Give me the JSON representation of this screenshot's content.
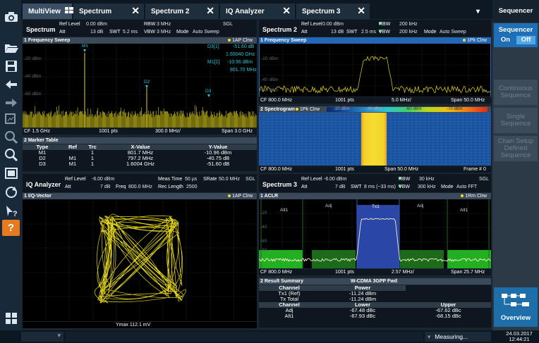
{
  "tabs": [
    {
      "label": "MultiView",
      "active": true
    },
    {
      "label": "Spectrum"
    },
    {
      "label": "Spectrum 2"
    },
    {
      "label": "IQ Analyzer"
    },
    {
      "label": "Spectrum 3"
    }
  ],
  "sequencer": {
    "title": "Sequencer",
    "switch_label": "Sequencer",
    "on": "On",
    "off": "Off",
    "continuous": "Continuous Sequence",
    "single": "Single Sequence",
    "chan_setup": "Chan Setup Defined Sequence",
    "overview": "Overview"
  },
  "spec1": {
    "name": "Spectrum",
    "ref_level_l": "Ref Level",
    "ref_level": "0.00 dBm",
    "att_l": "Att",
    "att": "13 dB",
    "swt_l": "SWT",
    "swt": "5.2 ms",
    "rbw_l": "RBW",
    "rbw": "3 MHz",
    "vbw_l": "VBW",
    "vbw": "3 MHz",
    "mode_l": "Mode",
    "mode": "Auto Sweep",
    "sgl": "SGL",
    "window": "1 Frequency Sweep",
    "trace": "1AP Clrw",
    "grid": [
      "-20 dBm",
      "-40 dBm",
      "-60 dBm"
    ],
    "markers": [
      "M1",
      "D2",
      "D3"
    ],
    "readout": [
      "D3[1]",
      "-51.60 dB",
      "1.60040 GHz",
      "M1[1]",
      "-10.96 dBm",
      "801.70 MHz"
    ],
    "cf": "CF 1.5 GHz",
    "pts": "1001 pts",
    "div": "300.0 MHz/",
    "span": "Span 3.0 GHz"
  },
  "marker_table": {
    "title": "2 Marker Table",
    "headers": [
      "Type",
      "Ref",
      "Trc",
      "X-Value",
      "Y-Value"
    ],
    "rows": [
      [
        "M1",
        "",
        "1",
        "801.7 MHz",
        "-10.96 dBm"
      ],
      [
        "D2",
        "M1",
        "1",
        "797.2 MHz",
        "-40.75 dB"
      ],
      [
        "D3",
        "M1",
        "1",
        "1.6004 GHz",
        "-51.60 dB"
      ]
    ]
  },
  "iq": {
    "name": "IQ Analyzer",
    "ref_level_l": "Ref Level",
    "ref_level": "-6.00 dBm",
    "att_l": "Att",
    "att": "7 dB",
    "freq_l": "Freq",
    "freq": "800.0 MHz",
    "meas_l": "Meas Time",
    "meas": "50 µs",
    "rec_l": "Rec Length",
    "rec": "2500",
    "srate_l": "SRate",
    "srate": "50.0 MHz",
    "sgl": "SGL",
    "window": "1 I/Q-Vector",
    "trace": "1AP Clrw",
    "ymax": "Ymax 112.1 mV"
  },
  "spec2": {
    "name": "Spectrum 2",
    "ref_level_l": "Ref Level",
    "ref_level": "0.00 dBm",
    "att_l": "Att",
    "att": "13 dB",
    "swt_l": "SWT",
    "swt": "2.5 ms",
    "rbw_l": "RBW",
    "rbw": "200 kHz",
    "vbw_l": "VBW",
    "vbw": "200 kHz",
    "mode_l": "Mode",
    "mode": "Auto Sweep",
    "window": "1 Frequency Sweep",
    "trace": "1Pk Clrw",
    "grid": [
      "-20 dBm",
      "-40 dBm",
      "-60 dBm"
    ],
    "cf": "CF 800.0 MHz",
    "pts": "1001 pts",
    "div": "5.0 MHz/",
    "span": "Span 50.0 MHz",
    "spectro": "2 Spectrogram",
    "spectro_trace": "1Pk Clrw",
    "scale": [
      "-10 dBm",
      "-20 dBm",
      "-30 dBm",
      "-40 dBm",
      "-50 dBm",
      "-60 dBm",
      "-70 dBm",
      "-80 dBm"
    ],
    "frame": "Frame # 0"
  },
  "spec3": {
    "name": "Spectrum 3",
    "ref_level_l": "Ref Level",
    "ref_level": "-6.00 dBm",
    "att_l": "Att",
    "att": "7 dB",
    "swt_l": "SWT",
    "swt": "8 ms (~33 ms)",
    "rbw_l": "RBW",
    "rbw": "30 kHz",
    "vbw_l": "VBW",
    "vbw": "300 kHz",
    "mode_l": "Mode",
    "mode": "Auto FFT",
    "sgl": "SGL",
    "window": "1 ACLR",
    "trace": "1Rm Clrw",
    "channels": [
      "Alt1",
      "Adj",
      "Tx1",
      "Adj",
      "Alt1"
    ],
    "grid": [
      "-20",
      "-40",
      "-60",
      "-80"
    ],
    "cf": "CF 800.0 MHz",
    "pts": "1001 pts",
    "div": "2.57 MHz/",
    "span": "Span 25.7 MHz"
  },
  "result": {
    "title": "2 Result Summary",
    "std": "W-CDMA 3GPP Fwd",
    "h1": [
      "Channel",
      "Power"
    ],
    "r1": [
      [
        "Tx1 (Ref)",
        "-11.24 dBm"
      ],
      [
        "Tx Total",
        "-11.24 dBm"
      ]
    ],
    "h2": [
      "Channel",
      "Lower",
      "Upper"
    ],
    "r2": [
      [
        "Adj",
        "-67.48 dBc",
        "-67.62 dBc"
      ],
      [
        "Alt1",
        "-67.93 dBc",
        "-68.15 dBc"
      ]
    ]
  },
  "status": {
    "measuring": "Measuring...",
    "date": "24.03.2017",
    "time": "12:44:21"
  }
}
